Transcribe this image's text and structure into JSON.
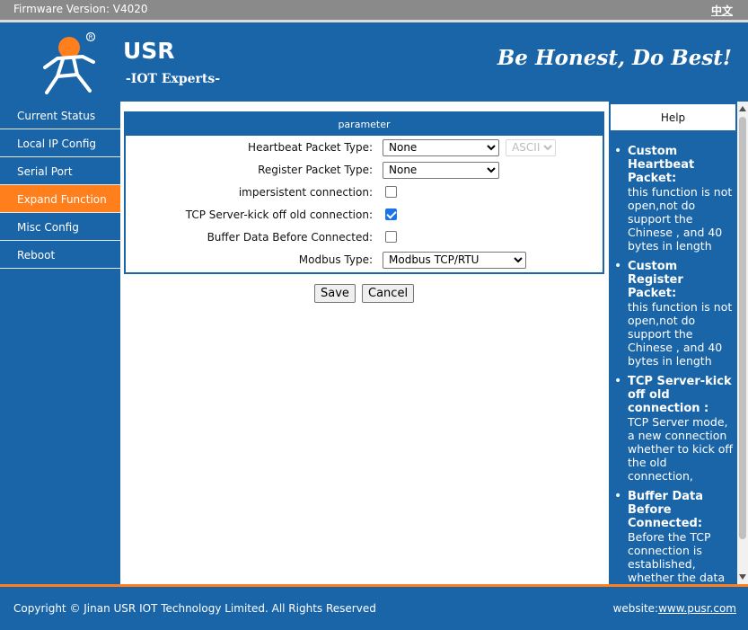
{
  "topbar": {
    "firmware": "Firmware Version: V4020",
    "lang": "中文"
  },
  "header": {
    "brand": "USR",
    "brand_sub": "-IOT Experts-",
    "slogan": "Be Honest, Do Best!",
    "logo_icon": "usr-runner-logo-icon"
  },
  "sidebar": {
    "items": [
      {
        "label": "Current Status"
      },
      {
        "label": "Local IP Config"
      },
      {
        "label": "Serial Port"
      },
      {
        "label": "Expand Function",
        "active": true
      },
      {
        "label": "Misc Config"
      },
      {
        "label": "Reboot"
      }
    ]
  },
  "parameter": {
    "title": "parameter",
    "heartbeat": {
      "label": "Heartbeat Packet Type:",
      "value": "None",
      "format": "ASCII"
    },
    "register": {
      "label": "Register Packet Type:",
      "value": "None"
    },
    "impersistent": {
      "label": "impersistent connection:",
      "checked": false
    },
    "kickoff": {
      "label": "TCP Server-kick off old connection:",
      "checked": true
    },
    "buffer": {
      "label": "Buffer Data Before Connected:",
      "checked": false
    },
    "modbus": {
      "label": "Modbus Type:",
      "value": "Modbus TCP/RTU"
    }
  },
  "buttons": {
    "save": "Save",
    "cancel": "Cancel"
  },
  "help": {
    "title": "Help",
    "items": [
      {
        "title": "Custom Heartbeat Packet:",
        "text": "this function is not open,not do support the Chinese , and 40 bytes in length"
      },
      {
        "title": "Custom Register Packet:",
        "text": "this function is not open,not do support the Chinese , and 40 bytes in length"
      },
      {
        "title": "TCP Server-kick off old connection :",
        "text": "TCP Server mode, a new connection whether to kick off the old connection,"
      },
      {
        "title": "Buffer Data Before Connected:",
        "text": "Before the TCP connection is established, whether the data sent by serial port is cached"
      }
    ]
  },
  "footer": {
    "copyright": "Copyright © Jinan USR IOT Technology Limited. All Rights Reserved",
    "website_label": "website:",
    "website": "www.pusr.com"
  },
  "colors": {
    "brand_blue": "#1a64a8",
    "accent_orange": "#ff7f1d",
    "topbar_gray": "#8a8a8a"
  }
}
